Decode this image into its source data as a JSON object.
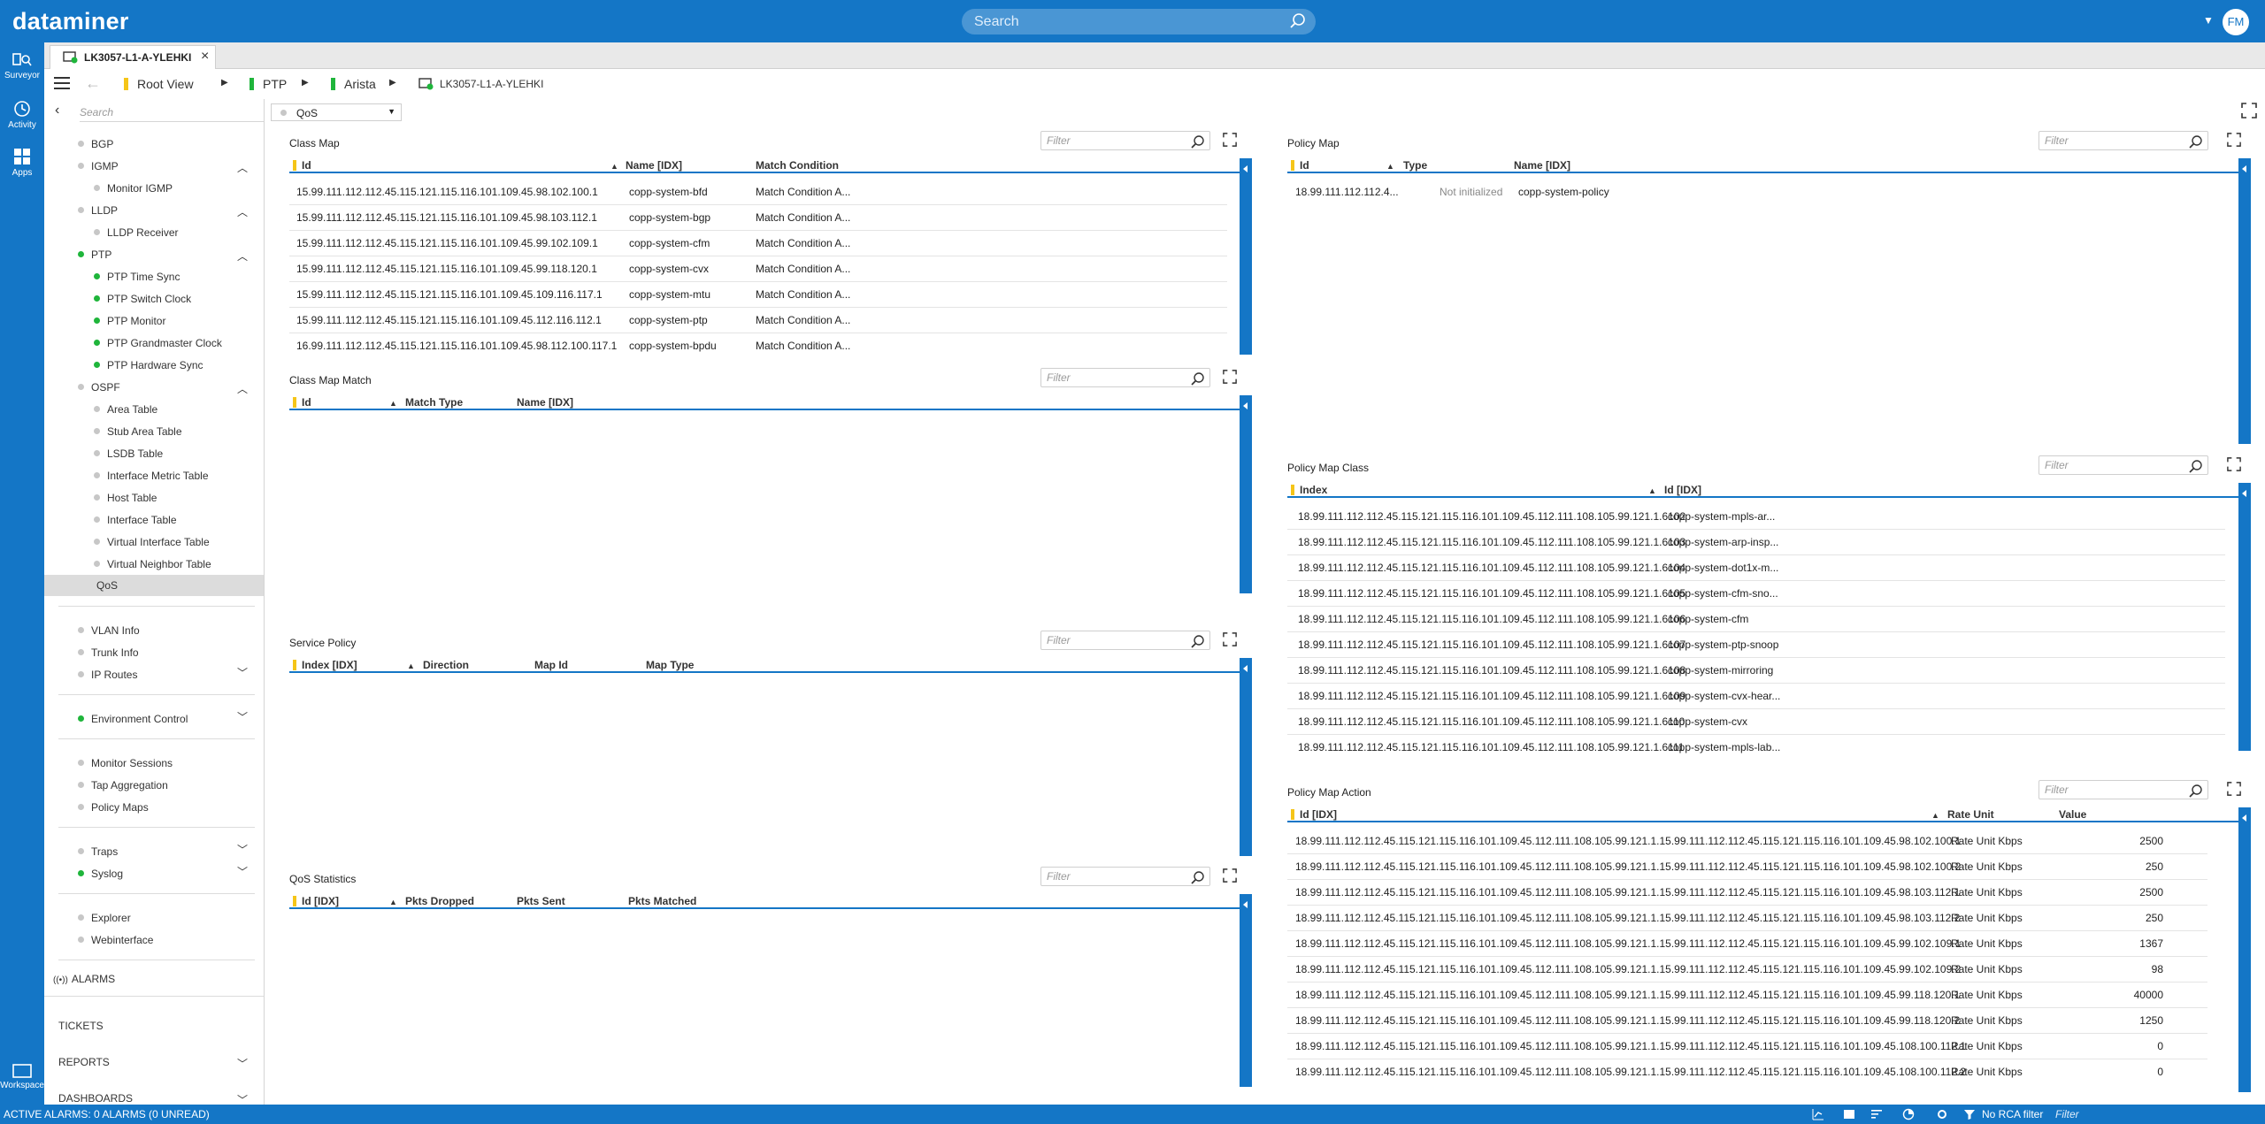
{
  "app": {
    "brand": "dataminer",
    "search_placeholder": "Search",
    "user_initials": "FM"
  },
  "rail": [
    {
      "label": "Surveyor",
      "icon": "surveyor-icon"
    },
    {
      "label": "Activity",
      "icon": "activity-icon"
    },
    {
      "label": "Apps",
      "icon": "apps-icon"
    },
    {
      "label": "Workspace",
      "icon": "workspace-icon"
    }
  ],
  "tab": {
    "label": "LK3057-L1-A-YLEHKI"
  },
  "breadcrumb": [
    {
      "label": "Root View",
      "color": "#f5c518"
    },
    {
      "label": "PTP",
      "color": "#1fb53b"
    },
    {
      "label": "Arista",
      "color": "#1fb53b"
    },
    {
      "label": "LK3057-L1-A-YLEHKI",
      "color": ""
    }
  ],
  "sidebar": {
    "search_placeholder": "Search",
    "items": [
      {
        "label": "BGP",
        "status": "grey"
      },
      {
        "label": "IGMP",
        "status": "grey"
      },
      {
        "label": "Monitor IGMP",
        "status": "grey"
      },
      {
        "label": "LLDP",
        "status": "grey"
      },
      {
        "label": "LLDP Receiver",
        "status": "grey"
      },
      {
        "label": "PTP",
        "status": "green"
      },
      {
        "label": "PTP Time Sync",
        "status": "green"
      },
      {
        "label": "PTP Switch Clock",
        "status": "green"
      },
      {
        "label": "PTP Monitor",
        "status": "green"
      },
      {
        "label": "PTP Grandmaster Clock",
        "status": "green"
      },
      {
        "label": "PTP Hardware Sync",
        "status": "green"
      },
      {
        "label": "OSPF",
        "status": "grey"
      },
      {
        "label": "Area Table",
        "status": "grey"
      },
      {
        "label": "Stub Area Table",
        "status": "grey"
      },
      {
        "label": "LSDB Table",
        "status": "grey"
      },
      {
        "label": "Interface Metric Table",
        "status": "grey"
      },
      {
        "label": "Host Table",
        "status": "grey"
      },
      {
        "label": "Interface Table",
        "status": "grey"
      },
      {
        "label": "Virtual Interface Table",
        "status": "grey"
      },
      {
        "label": "Virtual Neighbor Table",
        "status": "grey"
      },
      {
        "label": "QoS",
        "status": "none"
      },
      {
        "label": "VLAN Info",
        "status": "grey"
      },
      {
        "label": "Trunk Info",
        "status": "grey"
      },
      {
        "label": "IP Routes",
        "status": "grey"
      },
      {
        "label": "Environment Control",
        "status": "green"
      },
      {
        "label": "Monitor Sessions",
        "status": "grey"
      },
      {
        "label": "Tap Aggregation",
        "status": "grey"
      },
      {
        "label": "Policy Maps",
        "status": "grey"
      },
      {
        "label": "Traps",
        "status": "grey"
      },
      {
        "label": "Syslog",
        "status": "green"
      },
      {
        "label": "Explorer",
        "status": "grey"
      },
      {
        "label": "Webinterface",
        "status": "grey"
      }
    ],
    "alarms_label": "ALARMS",
    "sections": [
      "TICKETS",
      "REPORTS",
      "DASHBOARDS"
    ]
  },
  "page": {
    "selector": "QoS",
    "filter_placeholder": "Filter"
  },
  "class_map": {
    "title": "Class Map",
    "columns": [
      "Id",
      "Name [IDX]",
      "Match Condition"
    ],
    "rows": [
      [
        "15.99.111.112.112.45.115.121.115.116.101.109.45.98.102.100.1",
        "copp-system-bfd",
        "Match Condition A..."
      ],
      [
        "15.99.111.112.112.45.115.121.115.116.101.109.45.98.103.112.1",
        "copp-system-bgp",
        "Match Condition A..."
      ],
      [
        "15.99.111.112.112.45.115.121.115.116.101.109.45.99.102.109.1",
        "copp-system-cfm",
        "Match Condition A..."
      ],
      [
        "15.99.111.112.112.45.115.121.115.116.101.109.45.99.118.120.1",
        "copp-system-cvx",
        "Match Condition A..."
      ],
      [
        "15.99.111.112.112.45.115.121.115.116.101.109.45.109.116.117.1",
        "copp-system-mtu",
        "Match Condition A..."
      ],
      [
        "15.99.111.112.112.45.115.121.115.116.101.109.45.112.116.112.1",
        "copp-system-ptp",
        "Match Condition A..."
      ],
      [
        "16.99.111.112.112.45.115.121.115.116.101.109.45.98.112.100.117.1",
        "copp-system-bpdu",
        "Match Condition A..."
      ]
    ]
  },
  "class_map_match": {
    "title": "Class Map Match",
    "columns": [
      "Id",
      "Match Type",
      "Name [IDX]"
    ]
  },
  "service_policy": {
    "title": "Service Policy",
    "columns": [
      "Index [IDX]",
      "Direction",
      "Map Id",
      "Map Type"
    ]
  },
  "qos_statistics": {
    "title": "QoS Statistics",
    "columns": [
      "Id [IDX]",
      "Pkts Dropped",
      "Pkts Sent",
      "Pkts Matched"
    ]
  },
  "policy_map": {
    "title": "Policy Map",
    "columns": [
      "Id",
      "Type",
      "Name [IDX]"
    ],
    "rows": [
      [
        "18.99.111.112.112.4...",
        "Not initialized",
        "copp-system-policy"
      ]
    ]
  },
  "policy_map_class": {
    "title": "Policy Map Class",
    "columns": [
      "Index",
      "Id [IDX]"
    ],
    "rows": [
      [
        "18.99.111.112.112.45.115.121.115.116.101.109.45.112.111.108.105.99.121.1.6102",
        "copp-system-mpls-ar..."
      ],
      [
        "18.99.111.112.112.45.115.121.115.116.101.109.45.112.111.108.105.99.121.1.6103",
        "copp-system-arp-insp..."
      ],
      [
        "18.99.111.112.112.45.115.121.115.116.101.109.45.112.111.108.105.99.121.1.6104",
        "copp-system-dot1x-m..."
      ],
      [
        "18.99.111.112.112.45.115.121.115.116.101.109.45.112.111.108.105.99.121.1.6105",
        "copp-system-cfm-sno..."
      ],
      [
        "18.99.111.112.112.45.115.121.115.116.101.109.45.112.111.108.105.99.121.1.6106",
        "copp-system-cfm"
      ],
      [
        "18.99.111.112.112.45.115.121.115.116.101.109.45.112.111.108.105.99.121.1.6107",
        "copp-system-ptp-snoop"
      ],
      [
        "18.99.111.112.112.45.115.121.115.116.101.109.45.112.111.108.105.99.121.1.6108",
        "copp-system-mirroring"
      ],
      [
        "18.99.111.112.112.45.115.121.115.116.101.109.45.112.111.108.105.99.121.1.6109",
        "copp-system-cvx-hear..."
      ],
      [
        "18.99.111.112.112.45.115.121.115.116.101.109.45.112.111.108.105.99.121.1.6110",
        "copp-system-cvx"
      ],
      [
        "18.99.111.112.112.45.115.121.115.116.101.109.45.112.111.108.105.99.121.1.6111",
        "copp-system-mpls-lab..."
      ]
    ]
  },
  "policy_map_action": {
    "title": "Policy Map Action",
    "columns": [
      "Id [IDX]",
      "Rate Unit",
      "Value"
    ],
    "rows": [
      [
        "18.99.111.112.112.45.115.121.115.116.101.109.45.112.111.108.105.99.121.1.15.99.111.112.112.45.115.121.115.116.101.109.45.98.102.100.1",
        "Rate Unit Kbps",
        "2500"
      ],
      [
        "18.99.111.112.112.45.115.121.115.116.101.109.45.112.111.108.105.99.121.1.15.99.111.112.112.45.115.121.115.116.101.109.45.98.102.100.2",
        "Rate Unit Kbps",
        "250"
      ],
      [
        "18.99.111.112.112.45.115.121.115.116.101.109.45.112.111.108.105.99.121.1.15.99.111.112.112.45.115.121.115.116.101.109.45.98.103.112.1",
        "Rate Unit Kbps",
        "2500"
      ],
      [
        "18.99.111.112.112.45.115.121.115.116.101.109.45.112.111.108.105.99.121.1.15.99.111.112.112.45.115.121.115.116.101.109.45.98.103.112.2",
        "Rate Unit Kbps",
        "250"
      ],
      [
        "18.99.111.112.112.45.115.121.115.116.101.109.45.112.111.108.105.99.121.1.15.99.111.112.112.45.115.121.115.116.101.109.45.99.102.109.1",
        "Rate Unit Kbps",
        "1367"
      ],
      [
        "18.99.111.112.112.45.115.121.115.116.101.109.45.112.111.108.105.99.121.1.15.99.111.112.112.45.115.121.115.116.101.109.45.99.102.109.2",
        "Rate Unit Kbps",
        "98"
      ],
      [
        "18.99.111.112.112.45.115.121.115.116.101.109.45.112.111.108.105.99.121.1.15.99.111.112.112.45.115.121.115.116.101.109.45.99.118.120.1",
        "Rate Unit Kbps",
        "40000"
      ],
      [
        "18.99.111.112.112.45.115.121.115.116.101.109.45.112.111.108.105.99.121.1.15.99.111.112.112.45.115.121.115.116.101.109.45.99.118.120.2",
        "Rate Unit Kbps",
        "1250"
      ],
      [
        "18.99.111.112.112.45.115.121.115.116.101.109.45.112.111.108.105.99.121.1.15.99.111.112.112.45.115.121.115.116.101.109.45.108.100.112.1",
        "Rate Unit Kbps",
        "0"
      ],
      [
        "18.99.111.112.112.45.115.121.115.116.101.109.45.112.111.108.105.99.121.1.15.99.111.112.112.45.115.121.115.116.101.109.45.108.100.112.2",
        "Rate Unit Kbps",
        "0"
      ]
    ]
  },
  "statusbar": {
    "alarms": "ACTIVE ALARMS: 0 ALARMS (0 UNREAD)",
    "rca_filter": "No RCA filter",
    "filter_placeholder": "Filter"
  }
}
